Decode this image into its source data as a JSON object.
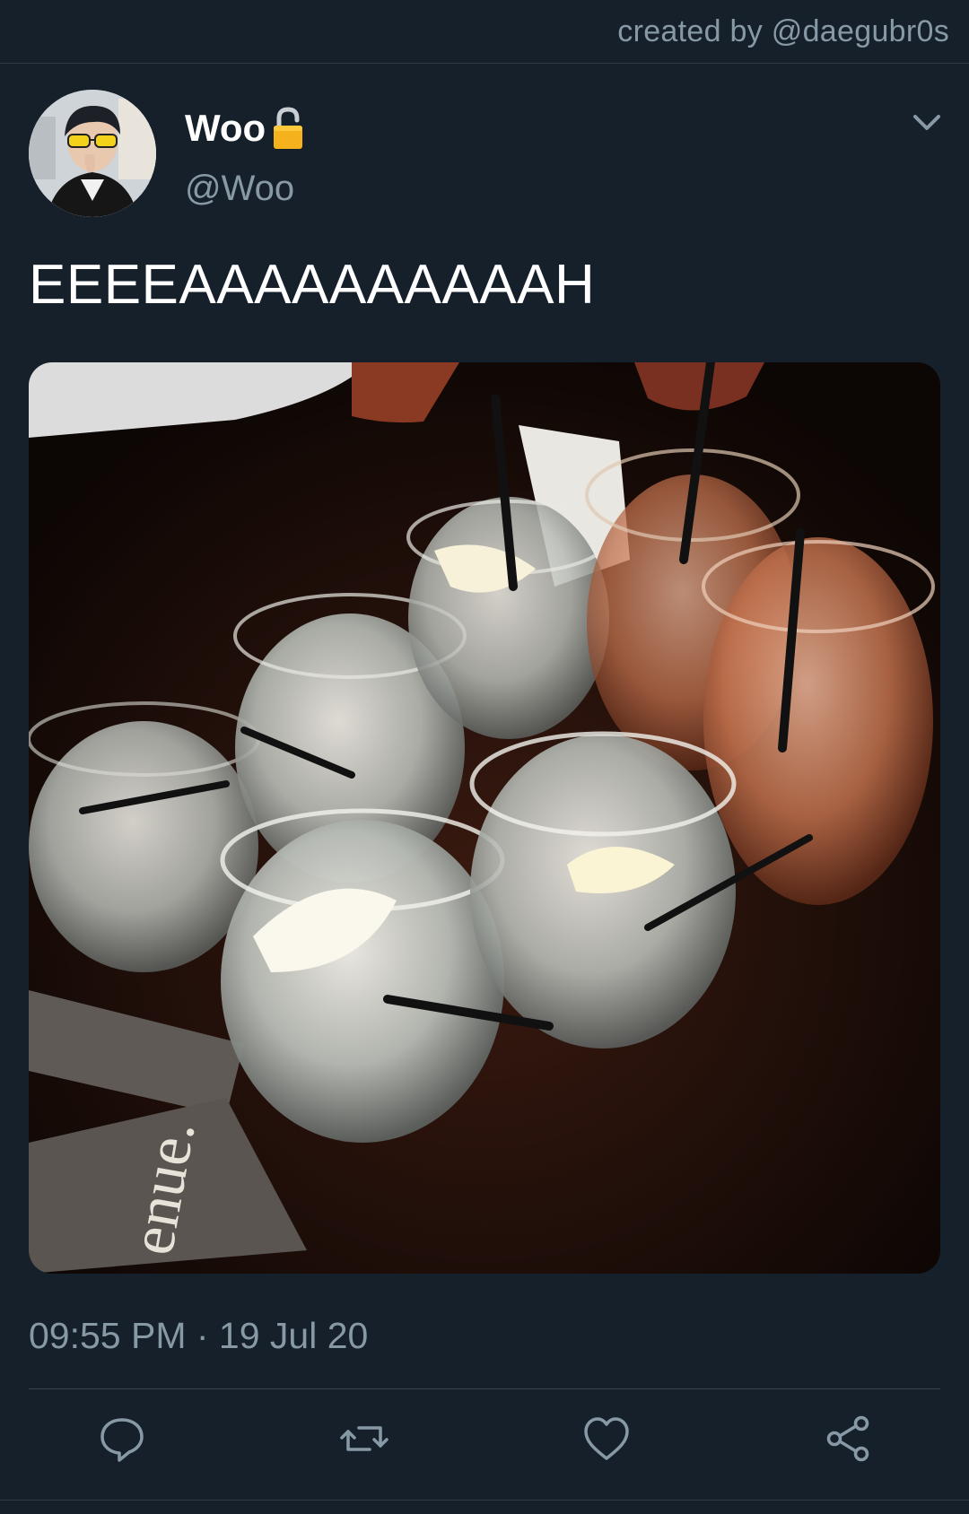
{
  "credit": "created by @daegubr0s",
  "tweet": {
    "display_name": "Woo",
    "handle": "@Woo",
    "text": "EEEEAAAAAAAAAAH",
    "timestamp": "09:55 PM · 19 Jul 20",
    "photo_alt": "",
    "account_badge_icon": "lock-icon",
    "menu_icon": "chevron-down-icon"
  },
  "actions": [
    {
      "icon": "reply-icon"
    },
    {
      "icon": "retweet-icon"
    },
    {
      "icon": "like-icon"
    },
    {
      "icon": "share-icon"
    }
  ],
  "colors": {
    "background": "#15202b",
    "secondary_text": "#8899a6",
    "divider": "#38444d",
    "lock_gold": "#f5b21d"
  }
}
